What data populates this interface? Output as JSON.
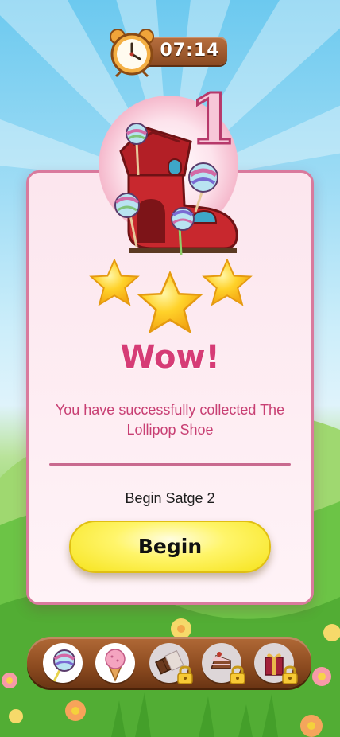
{
  "timer": {
    "value": "07:14",
    "icon": "alarm-clock-icon"
  },
  "level": {
    "number": "1",
    "reward_image": "lollipop-shoe-house"
  },
  "stars": {
    "earned": 3,
    "total": 3
  },
  "result": {
    "title": "Wow!",
    "message": "You have successfully collected The Lollipop Shoe",
    "next_stage_label": "Begin Satge 2",
    "begin_button": "Begin"
  },
  "collection": [
    {
      "name": "lollipop",
      "icon": "lollipop-icon",
      "locked": false
    },
    {
      "name": "ice-cream",
      "icon": "ice-cream-icon",
      "locked": false
    },
    {
      "name": "chocolate",
      "icon": "chocolate-icon",
      "locked": true
    },
    {
      "name": "cake",
      "icon": "cake-icon",
      "locked": true
    },
    {
      "name": "gift",
      "icon": "gift-icon",
      "locked": true
    }
  ],
  "colors": {
    "accent": "#d63c76",
    "button": "#f6e31c",
    "card_border": "#d97a9d"
  }
}
